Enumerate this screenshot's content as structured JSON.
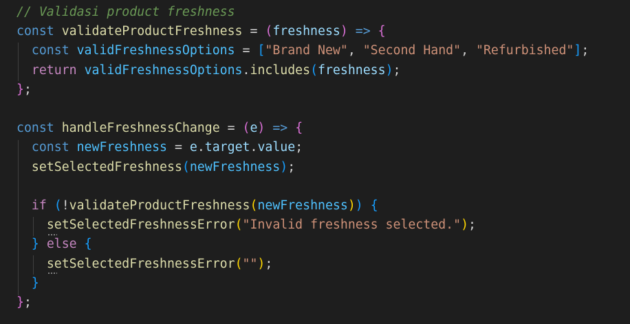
{
  "editor": {
    "lines": [
      {
        "tokens": [
          {
            "t": "// Validasi product freshness",
            "c": "cm"
          }
        ]
      },
      {
        "tokens": [
          {
            "t": "const",
            "c": "kw"
          },
          {
            "t": " ",
            "c": "op"
          },
          {
            "t": "validateProductFreshness",
            "c": "fn"
          },
          {
            "t": " = ",
            "c": "op"
          },
          {
            "t": "(",
            "c": "b2"
          },
          {
            "t": "freshness",
            "c": "var"
          },
          {
            "t": ")",
            "c": "b2"
          },
          {
            "t": " ",
            "c": "op"
          },
          {
            "t": "=>",
            "c": "kw"
          },
          {
            "t": " ",
            "c": "op"
          },
          {
            "t": "{",
            "c": "b2"
          }
        ]
      },
      {
        "tokens": [
          {
            "t": "  ",
            "c": "op"
          },
          {
            "t": "const",
            "c": "kw"
          },
          {
            "t": " ",
            "c": "op"
          },
          {
            "t": "validFreshnessOptions",
            "c": "cst"
          },
          {
            "t": " = ",
            "c": "op"
          },
          {
            "t": "[",
            "c": "b3"
          },
          {
            "t": "\"Brand New\"",
            "c": "str"
          },
          {
            "t": ", ",
            "c": "op"
          },
          {
            "t": "\"Second Hand\"",
            "c": "str"
          },
          {
            "t": ", ",
            "c": "op"
          },
          {
            "t": "\"Refurbished\"",
            "c": "str"
          },
          {
            "t": "]",
            "c": "b3"
          },
          {
            "t": ";",
            "c": "op"
          }
        ]
      },
      {
        "tokens": [
          {
            "t": "  ",
            "c": "op"
          },
          {
            "t": "return",
            "c": "ctl"
          },
          {
            "t": " ",
            "c": "op"
          },
          {
            "t": "validFreshnessOptions",
            "c": "cst"
          },
          {
            "t": ".",
            "c": "op"
          },
          {
            "t": "includes",
            "c": "fn"
          },
          {
            "t": "(",
            "c": "b3"
          },
          {
            "t": "freshness",
            "c": "var"
          },
          {
            "t": ")",
            "c": "b3"
          },
          {
            "t": ";",
            "c": "op"
          }
        ]
      },
      {
        "tokens": [
          {
            "t": "}",
            "c": "b2"
          },
          {
            "t": ";",
            "c": "op"
          }
        ]
      },
      {
        "tokens": []
      },
      {
        "tokens": [
          {
            "t": "const",
            "c": "kw"
          },
          {
            "t": " ",
            "c": "op"
          },
          {
            "t": "handleFreshnessChange",
            "c": "fn"
          },
          {
            "t": " = ",
            "c": "op"
          },
          {
            "t": "(",
            "c": "b2"
          },
          {
            "t": "e",
            "c": "var"
          },
          {
            "t": ")",
            "c": "b2"
          },
          {
            "t": " ",
            "c": "op"
          },
          {
            "t": "=>",
            "c": "kw"
          },
          {
            "t": " ",
            "c": "op"
          },
          {
            "t": "{",
            "c": "b2"
          }
        ]
      },
      {
        "tokens": [
          {
            "t": "  ",
            "c": "op"
          },
          {
            "t": "const",
            "c": "kw"
          },
          {
            "t": " ",
            "c": "op"
          },
          {
            "t": "newFreshness",
            "c": "cst"
          },
          {
            "t": " = ",
            "c": "op"
          },
          {
            "t": "e",
            "c": "var"
          },
          {
            "t": ".",
            "c": "op"
          },
          {
            "t": "target",
            "c": "var"
          },
          {
            "t": ".",
            "c": "op"
          },
          {
            "t": "value",
            "c": "var"
          },
          {
            "t": ";",
            "c": "op"
          }
        ]
      },
      {
        "tokens": [
          {
            "t": "  ",
            "c": "op"
          },
          {
            "t": "setSelectedFreshness",
            "c": "fn"
          },
          {
            "t": "(",
            "c": "b3"
          },
          {
            "t": "newFreshness",
            "c": "cst"
          },
          {
            "t": ")",
            "c": "b3"
          },
          {
            "t": ";",
            "c": "op"
          }
        ]
      },
      {
        "tokens": []
      },
      {
        "tokens": [
          {
            "t": "  ",
            "c": "op"
          },
          {
            "t": "if",
            "c": "ctl"
          },
          {
            "t": " ",
            "c": "op"
          },
          {
            "t": "(",
            "c": "b3"
          },
          {
            "t": "!",
            "c": "op"
          },
          {
            "t": "validateProductFreshness",
            "c": "fn"
          },
          {
            "t": "(",
            "c": "b1"
          },
          {
            "t": "newFreshness",
            "c": "cst"
          },
          {
            "t": ")",
            "c": "b1"
          },
          {
            "t": ")",
            "c": "b3"
          },
          {
            "t": " ",
            "c": "op"
          },
          {
            "t": "{",
            "c": "b3"
          }
        ]
      },
      {
        "tokens": [
          {
            "t": "    ",
            "c": "op"
          },
          {
            "t": "setSelectedFreshnessError",
            "c": "fn"
          },
          {
            "t": "(",
            "c": "b1"
          },
          {
            "t": "\"Invalid freshness selected.\"",
            "c": "str"
          },
          {
            "t": ")",
            "c": "b1"
          },
          {
            "t": ";",
            "c": "op"
          }
        ]
      },
      {
        "tokens": [
          {
            "t": "  ",
            "c": "op"
          },
          {
            "t": "}",
            "c": "b3"
          },
          {
            "t": " ",
            "c": "op"
          },
          {
            "t": "else",
            "c": "ctl"
          },
          {
            "t": " ",
            "c": "op"
          },
          {
            "t": "{",
            "c": "b3"
          }
        ]
      },
      {
        "tokens": [
          {
            "t": "    ",
            "c": "op"
          },
          {
            "t": "setSelectedFreshnessError",
            "c": "fn"
          },
          {
            "t": "(",
            "c": "b1"
          },
          {
            "t": "\"\"",
            "c": "str"
          },
          {
            "t": ")",
            "c": "b1"
          },
          {
            "t": ";",
            "c": "op"
          }
        ]
      },
      {
        "tokens": [
          {
            "t": "  ",
            "c": "op"
          },
          {
            "t": "}",
            "c": "b3"
          }
        ]
      },
      {
        "tokens": [
          {
            "t": "}",
            "c": "b2"
          },
          {
            "t": ";",
            "c": "op"
          }
        ]
      }
    ]
  },
  "colors": {
    "background": "#1e1e1e",
    "comment": "#6a9955",
    "keyword": "#569cd6",
    "control": "#c586c0",
    "function": "#dcdcaa",
    "variable": "#9cdcfe",
    "constant": "#4fc1ff",
    "string": "#ce9178",
    "bracket_gold": "#ffd700",
    "bracket_orchid": "#da70d6",
    "bracket_blue": "#179fff"
  }
}
